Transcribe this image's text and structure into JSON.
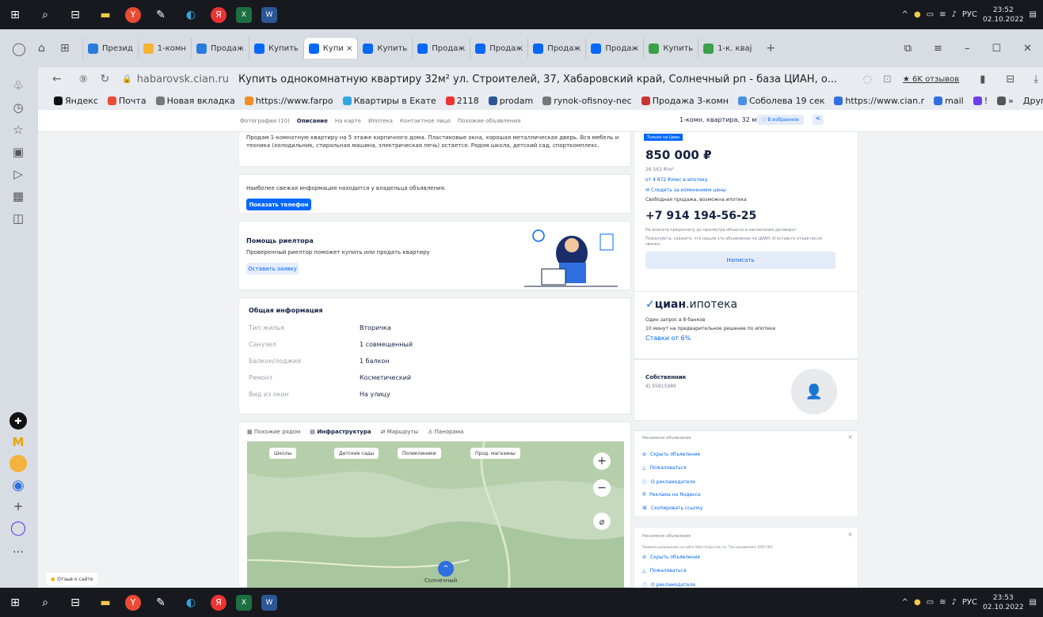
{
  "taskbar": {
    "tray_lang": "РУС",
    "time_top": "23:52",
    "date_top": "02.10.2022",
    "time_bottom": "23:53",
    "date_bottom": "02.10.2022"
  },
  "tabs": [
    {
      "label": "Презид",
      "color": "#2a7bde"
    },
    {
      "label": "1-комн",
      "color": "#f5b335"
    },
    {
      "label": "Продаж",
      "color": "#2a7bde"
    },
    {
      "label": "Купить",
      "color": "#0468ff"
    },
    {
      "label": "Купи ×",
      "color": "#0468ff"
    },
    {
      "label": "Купить",
      "color": "#0468ff"
    },
    {
      "label": "Продаж",
      "color": "#0468ff"
    },
    {
      "label": "Продаж",
      "color": "#0468ff"
    },
    {
      "label": "Продаж",
      "color": "#0468ff"
    },
    {
      "label": "Продаж",
      "color": "#0468ff"
    },
    {
      "label": "Купить",
      "color": "#3aa04a"
    },
    {
      "label": "1-к. квај",
      "color": "#3aa04a"
    }
  ],
  "address": {
    "domain": "habarovsk.cian.ru",
    "title": "Купить однокомнатную квартиру 32м² ул. Строителей, 37, Хабаровский край, Солнечный рп - база ЦИАН, о...",
    "reviews": "★ 6K отзывов"
  },
  "bookmarks": [
    "Яндекс",
    "Почта",
    "Новая вкладка",
    "https://www.farpo",
    "Квартиры в Екате",
    "2118",
    "prodam",
    "rynok-ofisnoy-nec",
    "Продажа 3-комн",
    "Соболева 19 сек",
    "https://www.cian.r",
    "mail",
    "!",
    "»"
  ],
  "bookmarks_other": "Другое ⌄",
  "subnav": {
    "items": [
      "Фотографии (10)",
      "Описание",
      "На карте",
      "Ипотека",
      "Контактное лицо",
      "Похожие объявления"
    ],
    "right_title": "1-комн. квартира, 32 м²",
    "fav": "♡ В избранное"
  },
  "description": "Продам 1-комнатную квартиру на 5 этаже кирпичного дома. Пластиковые окна, хорошая металлическая дверь. Вся мебель и техника (холодильник, стиральная машина, электрическая печь) остается. Рядом школа, детский сад, спорткомплекс.",
  "owner_info": {
    "text": "Наиболее свежая информация находится у владельца объявления.",
    "button": "Показать телефон"
  },
  "realtor": {
    "title": "Помощь риелтора",
    "text": "Проверенный риелтор поможет купить или продать квартиру",
    "button": "Оставить заявку"
  },
  "general": {
    "title": "Общая информация",
    "rows": [
      {
        "label": "Тип жилья",
        "value": "Вторичка"
      },
      {
        "label": "Санузел",
        "value": "1 совмещенный"
      },
      {
        "label": "Балкон/лоджия",
        "value": "1 балкон"
      },
      {
        "label": "Ремонт",
        "value": "Косметический"
      },
      {
        "label": "Вид из окон",
        "value": "На улицу"
      }
    ]
  },
  "map": {
    "tabs": [
      "Похожие рядом",
      "Инфраструктура",
      "Маршруты",
      "Панорама"
    ],
    "chips": [
      "Школы",
      "Детские сады",
      "Поликлиники",
      "Прод. магазины"
    ],
    "place": "Солнечный"
  },
  "price": {
    "badge": "Только на Циан",
    "value": "850 000 ₽",
    "per_m": "26 563 ₽/м²",
    "mortgage": "от 4 872 ₽/мес в ипотеку",
    "watch": "Следить за изменением цены",
    "sale_type": "Свободная продажа, возможна ипотека",
    "phone": "+7 914 194-56-25",
    "warn": "Не вносите предоплату до просмотра объекта и заключения договора!",
    "hint": "Пожалуйста, скажите, что нашли это объявление на ЦИАН. И оставьте отзыв после звонка",
    "write": "Написать"
  },
  "mortgage_ad": {
    "brand": "циан",
    "brand2": ".ипотека",
    "l1": "Один запрос в 8 банков",
    "l2": "10 минут на предварительное решение по ипотеке",
    "rate": "Ставки от 6%"
  },
  "owner": {
    "title": "Собственник",
    "id": "ID 95815989"
  },
  "ad_box1": {
    "title": "Рекламное объявление",
    "items": [
      "Скрыть объявление",
      "Пожаловаться",
      "О рекламодателе",
      "Реклама на Яндексе",
      "Скопировать ссылку"
    ]
  },
  "ad_box2": {
    "title": "Рекламное объявление",
    "sub": "Правила размещения на сайте https://mpo.cian.ru/. Так называемая: ООО СЕО",
    "items": [
      "Скрыть объявление",
      "Пожаловаться",
      "О рекламодателе"
    ]
  },
  "feedback": "Отзыв о сайте"
}
